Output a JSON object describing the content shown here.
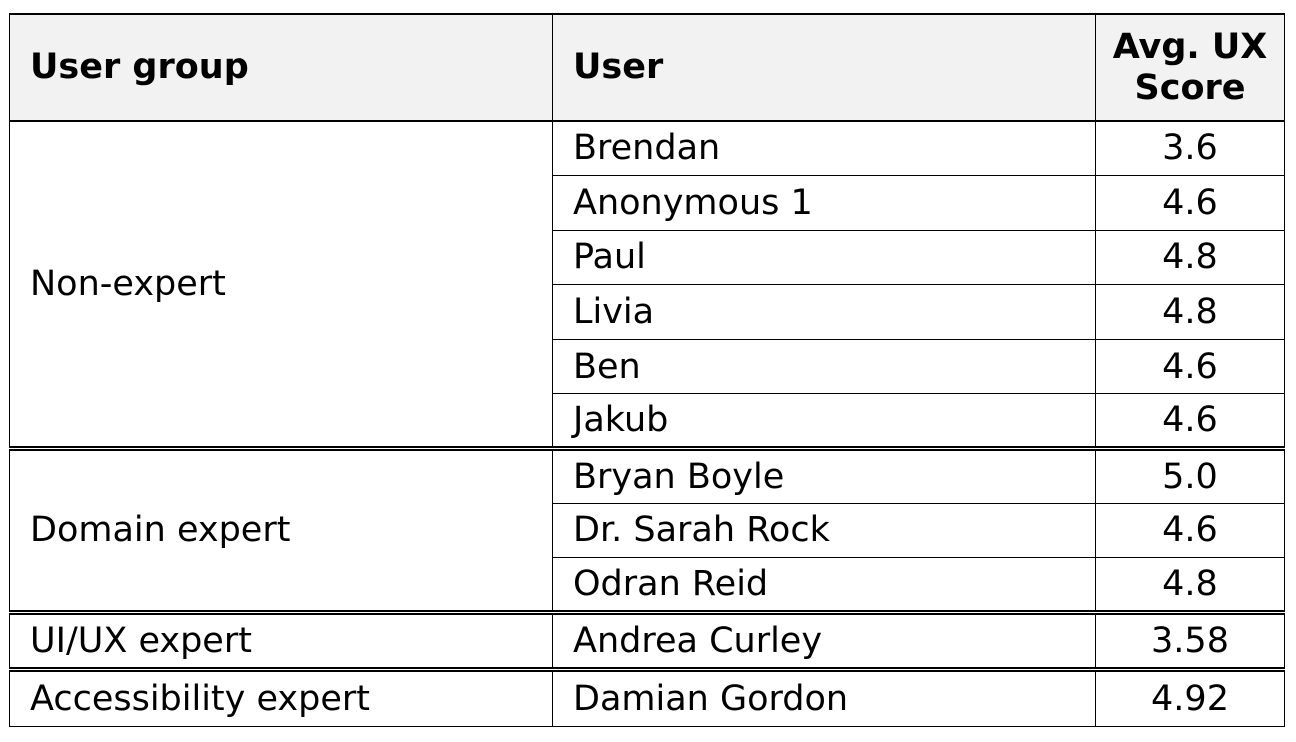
{
  "table": {
    "headers": {
      "group": "User group",
      "user": "User",
      "score": "Avg. UX Score"
    },
    "groups": [
      {
        "name": "Non-expert",
        "rows": [
          {
            "user": "Brendan",
            "score": "3.6"
          },
          {
            "user": "Anonymous 1",
            "score": "4.6"
          },
          {
            "user": "Paul",
            "score": "4.8"
          },
          {
            "user": "Livia",
            "score": "4.8"
          },
          {
            "user": "Ben",
            "score": "4.6"
          },
          {
            "user": "Jakub",
            "score": "4.6"
          }
        ]
      },
      {
        "name": "Domain expert",
        "rows": [
          {
            "user": "Bryan Boyle",
            "score": "5.0"
          },
          {
            "user": "Dr. Sarah Rock",
            "score": "4.6"
          },
          {
            "user": "Odran Reid",
            "score": "4.8"
          }
        ]
      },
      {
        "name": "UI/UX expert",
        "rows": [
          {
            "user": "Andrea Curley",
            "score": "3.58"
          }
        ]
      },
      {
        "name": "Accessibility expert",
        "rows": [
          {
            "user": "Damian Gordon",
            "score": "4.92"
          }
        ]
      }
    ]
  }
}
